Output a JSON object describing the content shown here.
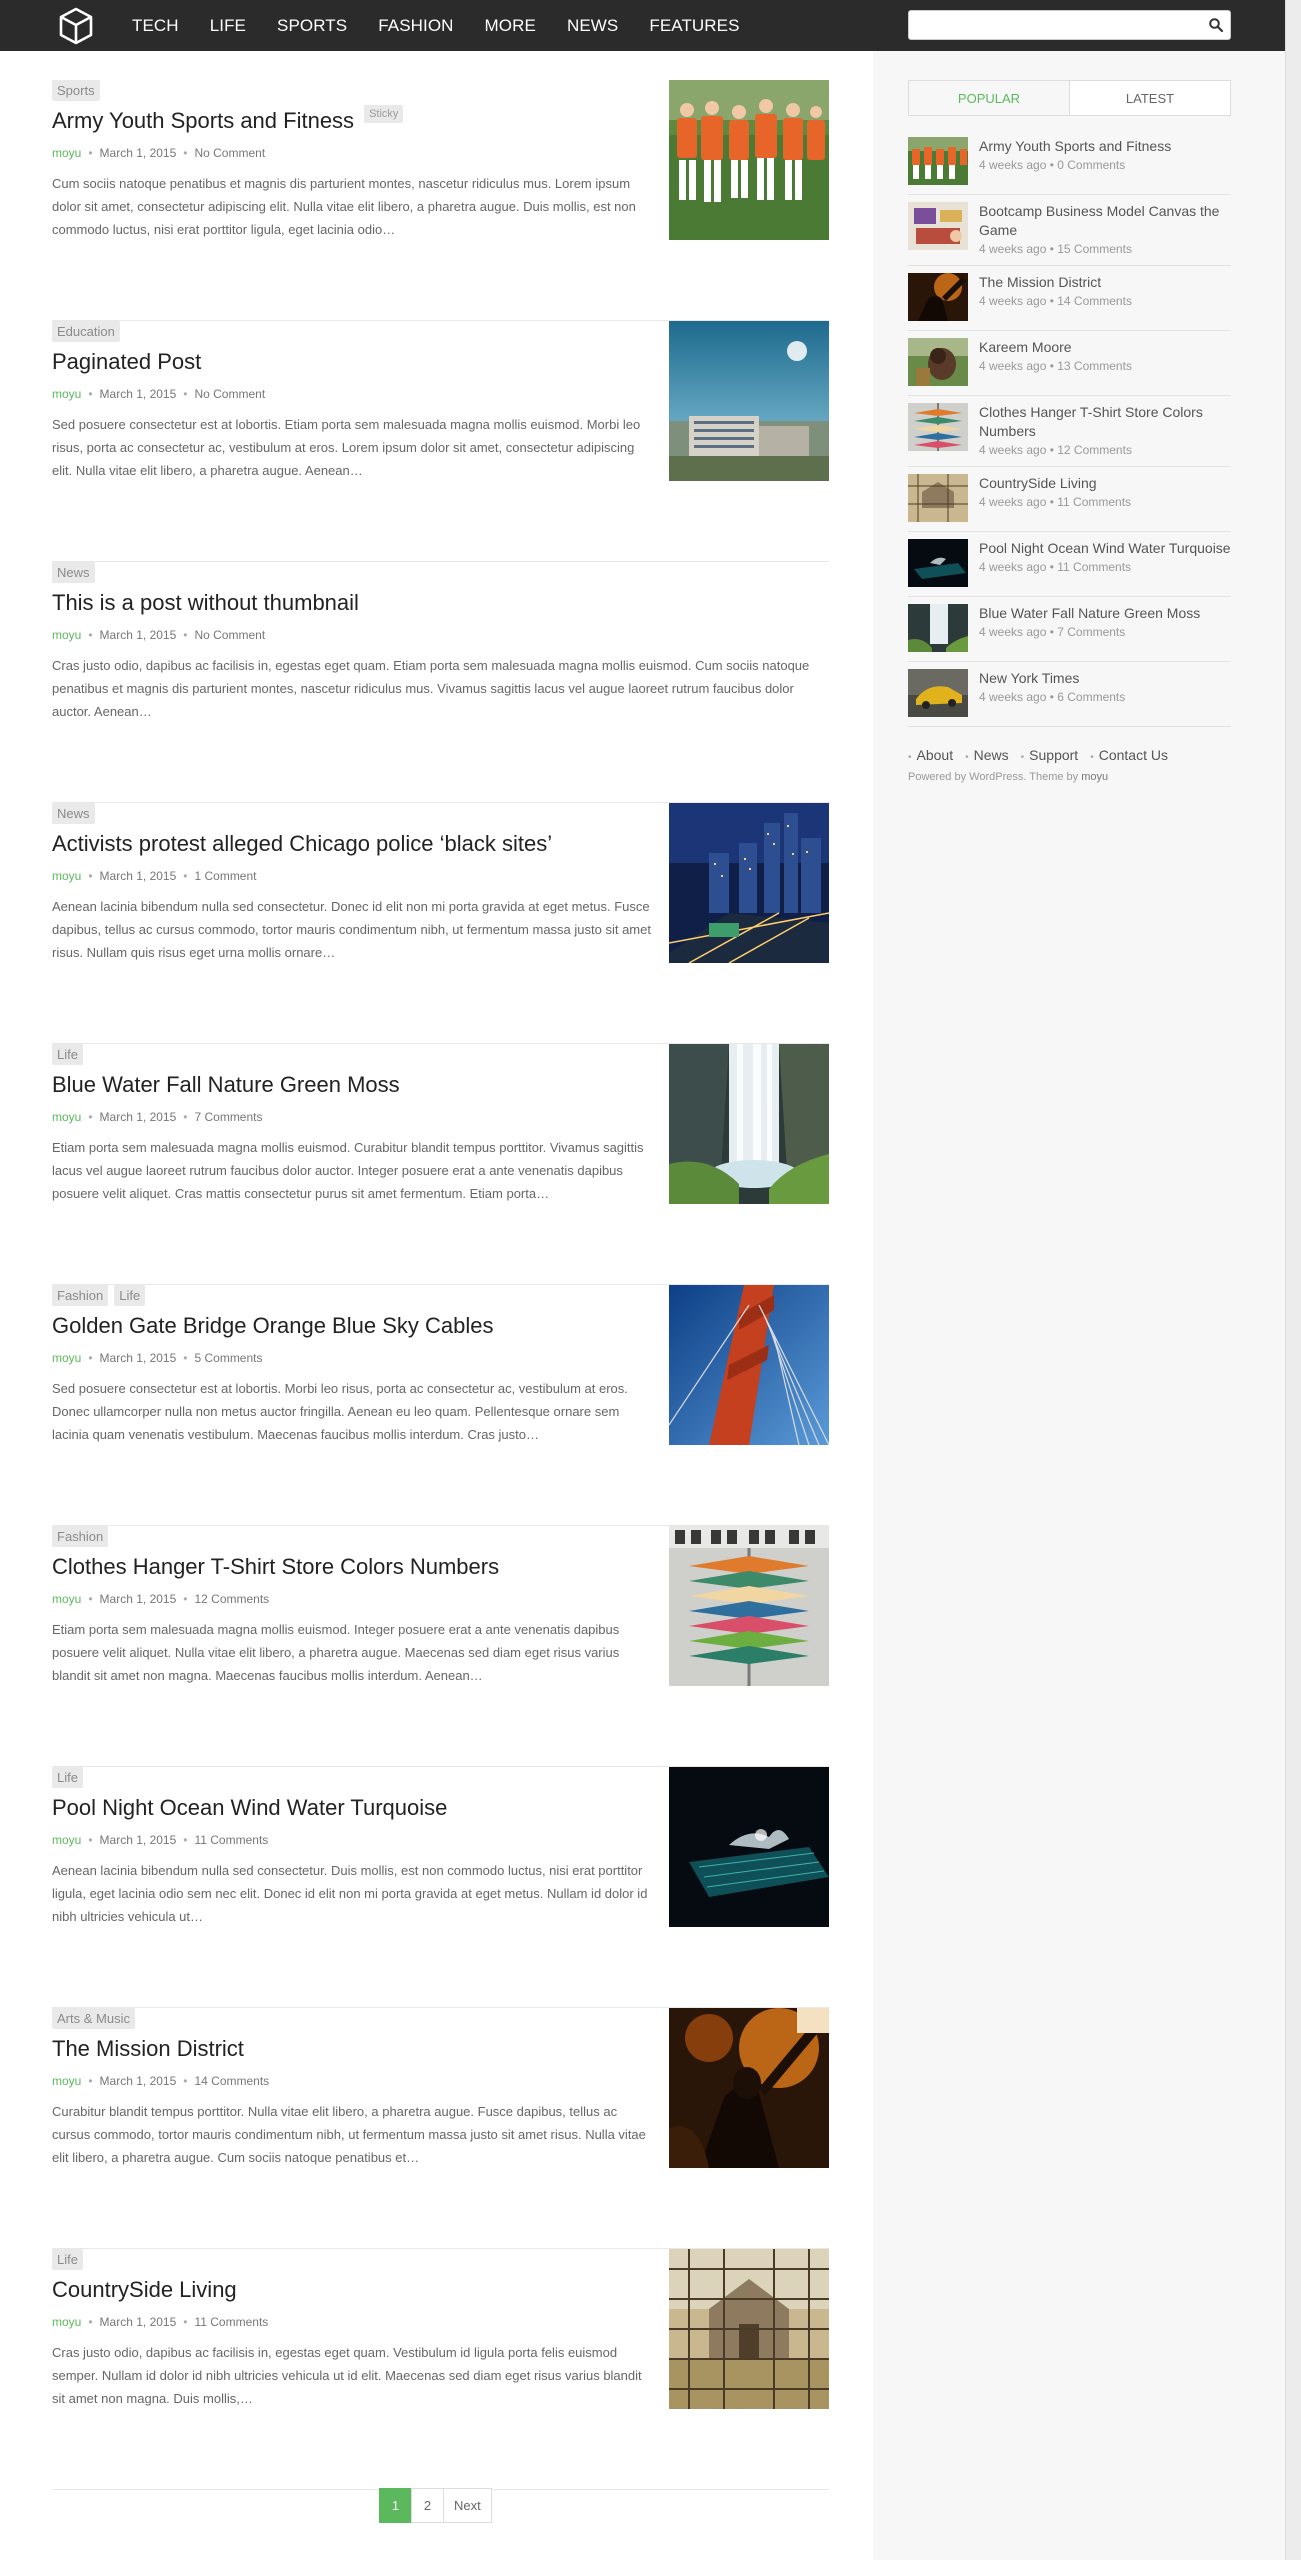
{
  "nav": {
    "items": [
      "TECH",
      "LIFE",
      "SPORTS",
      "FASHION",
      "MORE",
      "NEWS",
      "FEATURES"
    ]
  },
  "search": {
    "placeholder": ""
  },
  "posts": [
    {
      "cats": [
        "Sports"
      ],
      "title": "Army Youth Sports and Fitness",
      "sticky": "Sticky",
      "author": "moyu",
      "date": "March 1, 2015",
      "comments": "No Comment",
      "excerpt": "Cum sociis natoque penatibus et magnis dis parturient montes, nascetur ridiculus mus. Lorem ipsum dolor sit amet, consectetur adipiscing elit. Nulla vitae elit libero, a pharetra augue. Duis mollis, est non commodo luctus, nisi erat porttitor ligula, eget lacinia odio…",
      "has_thumb": true
    },
    {
      "cats": [
        "Education"
      ],
      "title": "Paginated Post",
      "author": "moyu",
      "date": "March 1, 2015",
      "comments": "No Comment",
      "excerpt": "Sed posuere consectetur est at lobortis. Etiam porta sem malesuada magna mollis euismod. Morbi leo risus, porta ac consectetur ac, vestibulum at eros. Lorem ipsum dolor sit amet, consectetur adipiscing elit. Nulla vitae elit libero, a pharetra augue.   Aenean…",
      "has_thumb": true
    },
    {
      "cats": [
        "News"
      ],
      "title": "This is a post without thumbnail",
      "author": "moyu",
      "date": "March 1, 2015",
      "comments": "No Comment",
      "excerpt": "Cras justo odio, dapibus ac facilisis in, egestas eget quam. Etiam porta sem malesuada magna mollis euismod. Cum sociis natoque penatibus et magnis dis parturient montes, nascetur ridiculus mus. Vivamus sagittis lacus vel augue laoreet rutrum faucibus dolor auctor. Aenean…",
      "has_thumb": false
    },
    {
      "cats": [
        "News"
      ],
      "title": "Activists protest alleged Chicago police ‘black sites’",
      "author": "moyu",
      "date": "March 1, 2015",
      "comments": "1 Comment",
      "excerpt": "Aenean lacinia bibendum nulla sed consectetur. Donec id elit non mi porta gravida at eget metus. Fusce dapibus, tellus ac cursus commodo, tortor mauris condimentum nibh, ut fermentum massa justo sit amet risus. Nullam quis risus eget urna mollis ornare…",
      "has_thumb": true
    },
    {
      "cats": [
        "Life"
      ],
      "title": "Blue Water Fall Nature Green Moss",
      "author": "moyu",
      "date": "March 1, 2015",
      "comments": "7 Comments",
      "excerpt": "Etiam porta sem malesuada magna mollis euismod. Curabitur blandit tempus porttitor. Vivamus sagittis lacus vel augue laoreet rutrum faucibus dolor auctor. Integer posuere erat a ante venenatis dapibus posuere velit aliquet. Cras mattis consectetur purus sit amet fermentum. Etiam porta…",
      "has_thumb": true
    },
    {
      "cats": [
        "Fashion",
        "Life"
      ],
      "title": "Golden Gate Bridge Orange Blue Sky Cables",
      "author": "moyu",
      "date": "March 1, 2015",
      "comments": "5 Comments",
      "excerpt": "Sed posuere consectetur est at lobortis. Morbi leo risus, porta ac consectetur ac, vestibulum at eros. Donec ullamcorper nulla non metus auctor fringilla. Aenean eu leo quam. Pellentesque ornare sem lacinia quam venenatis vestibulum. Maecenas faucibus mollis interdum. Cras justo…",
      "has_thumb": true
    },
    {
      "cats": [
        "Fashion"
      ],
      "title": "Clothes Hanger T-Shirt Store Colors Numbers",
      "author": "moyu",
      "date": "March 1, 2015",
      "comments": "12 Comments",
      "excerpt": "Etiam porta sem malesuada magna mollis euismod. Integer posuere erat a ante venenatis dapibus posuere velit aliquet. Nulla vitae elit libero, a pharetra augue. Maecenas sed diam eget risus varius blandit sit amet non magna. Maecenas faucibus mollis interdum. Aenean…",
      "has_thumb": true
    },
    {
      "cats": [
        "Life"
      ],
      "title": "Pool Night Ocean Wind Water Turquoise",
      "author": "moyu",
      "date": "March 1, 2015",
      "comments": "11 Comments",
      "excerpt": "Aenean lacinia bibendum nulla sed consectetur. Duis mollis, est non commodo luctus, nisi erat porttitor ligula, eget lacinia odio sem nec elit. Donec id elit non mi porta gravida at eget metus. Nullam id dolor id nibh ultricies vehicula ut…",
      "has_thumb": true
    },
    {
      "cats": [
        "Arts & Music"
      ],
      "title": "The Mission District",
      "author": "moyu",
      "date": "March 1, 2015",
      "comments": "14 Comments",
      "excerpt": "Curabitur blandit tempus porttitor. Nulla vitae elit libero, a pharetra augue. Fusce dapibus, tellus ac cursus commodo, tortor mauris condimentum nibh, ut fermentum massa justo sit amet risus. Nulla vitae elit libero, a pharetra augue. Cum sociis natoque penatibus et…",
      "has_thumb": true
    },
    {
      "cats": [
        "Life"
      ],
      "title": "CountrySide Living",
      "author": "moyu",
      "date": "March 1, 2015",
      "comments": "11 Comments",
      "excerpt": "Cras justo odio, dapibus ac facilisis in, egestas eget quam. Vestibulum id ligula porta felis euismod semper. Nullam id dolor id nibh ultricies vehicula ut id elit. Maecenas sed diam eget risus varius blandit sit amet non magna. Duis mollis,…",
      "has_thumb": true
    }
  ],
  "pagination": {
    "pages": [
      "1",
      "2"
    ],
    "current": "1",
    "next": "Next"
  },
  "sidebar": {
    "tabs": [
      "POPULAR",
      "LATEST"
    ],
    "active_tab": "POPULAR",
    "items": [
      {
        "title": "Army Youth Sports and Fitness",
        "meta": "4 weeks ago • 0 Comments"
      },
      {
        "title": "Bootcamp Business Model Canvas the Game",
        "meta": "4 weeks ago • 15 Comments"
      },
      {
        "title": "The Mission District",
        "meta": "4 weeks ago • 14 Comments"
      },
      {
        "title": "Kareem Moore",
        "meta": "4 weeks ago • 13 Comments"
      },
      {
        "title": "Clothes Hanger T-Shirt Store Colors Numbers",
        "meta": "4 weeks ago • 12 Comments"
      },
      {
        "title": "CountrySide Living",
        "meta": "4 weeks ago • 11 Comments"
      },
      {
        "title": "Pool Night Ocean Wind Water Turquoise",
        "meta": "4 weeks ago • 11 Comments"
      },
      {
        "title": "Blue Water Fall Nature Green Moss",
        "meta": "4 weeks ago • 7 Comments"
      },
      {
        "title": "New York Times",
        "meta": "4 weeks ago • 6 Comments"
      }
    ],
    "footer_links": [
      "About",
      "News",
      "Support",
      "Contact Us"
    ],
    "powered_prefix": "Powered by WordPress. Theme by ",
    "powered_author": "moyu"
  },
  "colors": {
    "accent": "#5cb85c",
    "topbar": "#2b2b2b",
    "sidebar_bg": "#f7f7f7"
  },
  "icons": {
    "logo": "cube-logo-icon",
    "search": "search-icon"
  }
}
